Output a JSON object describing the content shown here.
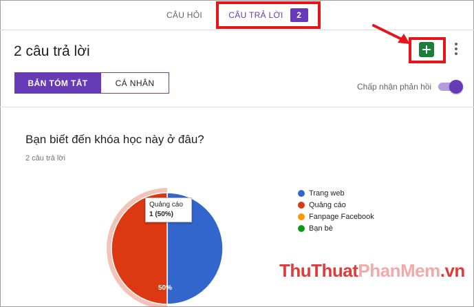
{
  "tabs": {
    "questions_label": "CÂU HỎI",
    "responses_label": "CÂU TRẢ LỜI",
    "responses_count": "2"
  },
  "header": {
    "title": "2 câu trả lời",
    "sheets_icon": "google-sheets-icon",
    "more_icon": "more-vert-icon"
  },
  "view_toggle": {
    "summary_label": "BẢN TÓM TẮT",
    "individual_label": "CÁ NHÂN"
  },
  "accepting": {
    "label": "Chấp nhận phản hồi",
    "enabled": true
  },
  "question": {
    "title": "Bạn biết đến khóa học này ở đâu?",
    "response_count": "2 câu trả lời"
  },
  "chart_data": {
    "type": "pie",
    "categories": [
      "Trang web",
      "Quảng cáo",
      "Fanpage Facebook",
      "Bạn bè"
    ],
    "values": [
      1,
      1,
      0,
      0
    ],
    "colors": [
      "#3366cc",
      "#dc3912",
      "#ff9900",
      "#109618"
    ],
    "slice_labels": [
      "50%",
      "",
      "",
      ""
    ],
    "tooltip": {
      "category": "Quảng cáo",
      "value_text": "1 (50%)"
    },
    "legend_position": "right"
  },
  "annotations": {
    "highlight_color": "#e8141c"
  },
  "watermark": {
    "part1": "ThuThuat",
    "part2": "PhanMem",
    "part3": ".vn"
  }
}
